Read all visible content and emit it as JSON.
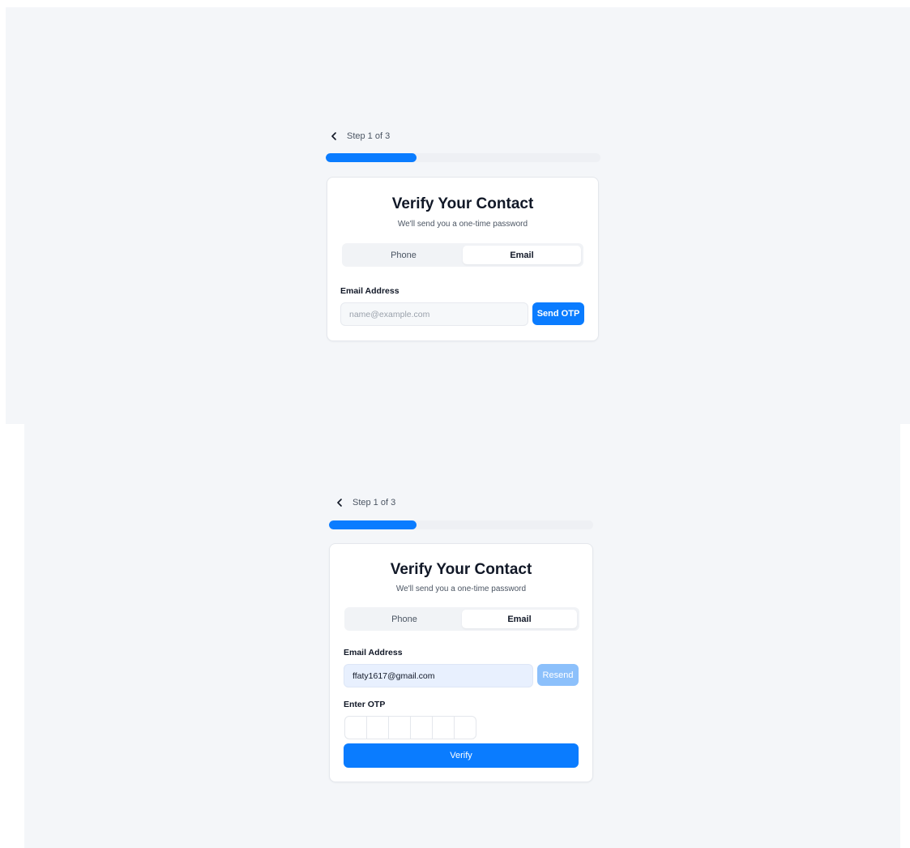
{
  "screen_1": {
    "step_label": "Step 1 of 3",
    "progress_fraction": 0.33,
    "title": "Verify Your Contact",
    "subtitle": "We'll send you a one-time password",
    "tabs": [
      {
        "label": "Phone",
        "active": false
      },
      {
        "label": "Email",
        "active": true
      }
    ],
    "email_label": "Email Address",
    "email_placeholder": "name@example.com",
    "email_value": "",
    "send_button": "Send OTP"
  },
  "screen_2": {
    "step_label": "Step 1 of 3",
    "progress_fraction": 0.33,
    "title": "Verify Your Contact",
    "subtitle": "We'll send you a one-time password",
    "tabs": [
      {
        "label": "Phone",
        "active": false
      },
      {
        "label": "Email",
        "active": true
      }
    ],
    "email_label": "Email Address",
    "email_value": "ffaty1617@gmail.com",
    "resend_button": "Resend",
    "otp_label": "Enter OTP",
    "otp_digits": [
      "",
      "",
      "",
      "",
      "",
      ""
    ],
    "verify_button": "Verify"
  },
  "icons": {
    "back": "chevron-left-icon"
  },
  "colors": {
    "accent": "#0a7cff",
    "accent_disabled": "#8cc0fb",
    "background": "#f4f6f9",
    "card": "#ffffff",
    "filled_input": "#e8f0fe"
  }
}
